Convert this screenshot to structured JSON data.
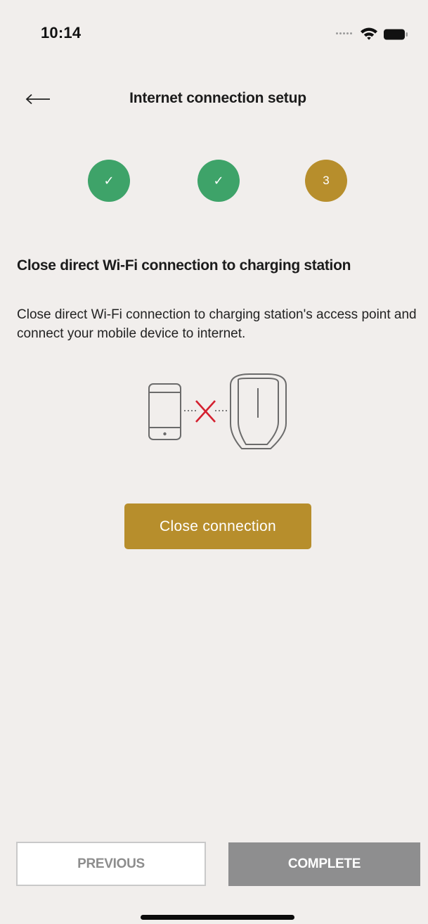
{
  "status_bar": {
    "time": "10:14"
  },
  "header": {
    "title": "Internet connection setup",
    "back_icon": "arrow-left-icon"
  },
  "steps": [
    {
      "state": "done",
      "icon": "check-icon",
      "label": "✓"
    },
    {
      "state": "done",
      "icon": "check-icon",
      "label": "✓"
    },
    {
      "state": "current",
      "label": "3"
    }
  ],
  "content": {
    "title": "Close direct Wi-Fi connection to charging station",
    "description": "Close direct Wi-Fi connection to charging station's access point and connect your mobile device to internet.",
    "illustration_icons": [
      "phone-icon",
      "disconnected-x-icon",
      "charging-station-icon"
    ],
    "primary_button": "Close connection"
  },
  "footer": {
    "previous_label": "PREVIOUS",
    "complete_label": "COMPLETE"
  },
  "colors": {
    "background": "#f1eeec",
    "accent_gold": "#b78e2c",
    "step_done_green": "#3ea369",
    "disabled_gray": "#8e8e8f",
    "error_red": "#d4202f"
  }
}
